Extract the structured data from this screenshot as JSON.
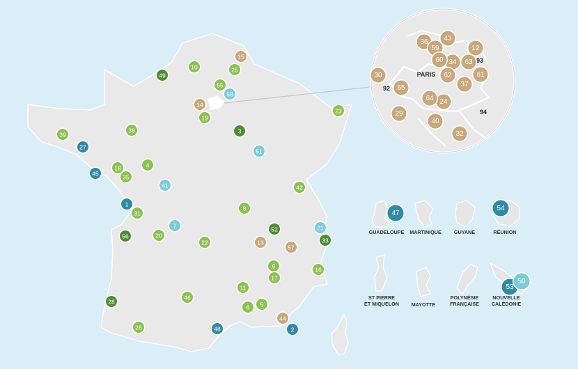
{
  "colors": {
    "lightgreen": "#8cc152",
    "darkgreen": "#4e8c34",
    "tan": "#c9a77a",
    "lightblue": "#7ccbd8",
    "teal": "#2f8aa6"
  },
  "paris_label": "PARIS",
  "depts": [
    "92",
    "93",
    "94"
  ],
  "territories": [
    "GUADELOUPE",
    "MARTINIQUE",
    "GUYANE",
    "RÉUNION",
    "ST PIERRE ET MIQUELON",
    "MAYOTTE",
    "POLYNÉSIE FRANÇAISE",
    "NOUVELLE CALÉDONIE"
  ],
  "territory_lines": [
    [
      "GUADELOUPE"
    ],
    [
      "MARTINIQUE"
    ],
    [
      "GUYANE"
    ],
    [
      "RÉUNION"
    ],
    [
      "ST PIERRE",
      "ET MIQUELON"
    ],
    [
      "MAYOTTE"
    ],
    [
      "POLYNÉSIE",
      "FRANÇAISE"
    ],
    [
      "NOUVELLE",
      "CALÉDONIE"
    ]
  ],
  "markers": [
    {
      "n": "1",
      "c": "teal"
    },
    {
      "n": "2",
      "c": "teal"
    },
    {
      "n": "3",
      "c": "darkgreen"
    },
    {
      "n": "4",
      "c": "lightgreen"
    },
    {
      "n": "5",
      "c": "lightgreen"
    },
    {
      "n": "6",
      "c": "lightgreen"
    },
    {
      "n": "7",
      "c": "lightblue"
    },
    {
      "n": "8",
      "c": "lightgreen"
    },
    {
      "n": "9",
      "c": "lightgreen"
    },
    {
      "n": "10",
      "c": "lightgreen"
    },
    {
      "n": "11",
      "c": "lightgreen"
    },
    {
      "n": "13",
      "c": "tan"
    },
    {
      "n": "14",
      "c": "tan"
    },
    {
      "n": "15",
      "c": "tan"
    },
    {
      "n": "16",
      "c": "lightgreen"
    },
    {
      "n": "17",
      "c": "lightgreen"
    },
    {
      "n": "18",
      "c": "lightgreen"
    },
    {
      "n": "19",
      "c": "lightgreen"
    },
    {
      "n": "20",
      "c": "lightgreen"
    },
    {
      "n": "21",
      "c": "lightblue"
    },
    {
      "n": "22",
      "c": "lightgreen"
    },
    {
      "n": "23",
      "c": "lightgreen"
    },
    {
      "n": "25",
      "c": "lightgreen"
    },
    {
      "n": "26",
      "c": "lightgreen"
    },
    {
      "n": "27",
      "c": "teal"
    },
    {
      "n": "28",
      "c": "darkgreen"
    },
    {
      "n": "31",
      "c": "lightgreen"
    },
    {
      "n": "33",
      "c": "darkgreen"
    },
    {
      "n": "35",
      "c": "lightgreen"
    },
    {
      "n": "38",
      "c": "lightgreen"
    },
    {
      "n": "39",
      "c": "lightgreen"
    },
    {
      "n": "41",
      "c": "lightblue"
    },
    {
      "n": "42",
      "c": "lightgreen"
    },
    {
      "n": "44",
      "c": "tan"
    },
    {
      "n": "45",
      "c": "teal"
    },
    {
      "n": "46",
      "c": "lightgreen"
    },
    {
      "n": "48",
      "c": "teal"
    },
    {
      "n": "49",
      "c": "darkgreen"
    },
    {
      "n": "51",
      "c": "lightblue"
    },
    {
      "n": "52",
      "c": "darkgreen"
    },
    {
      "n": "55",
      "c": "lightgreen"
    },
    {
      "n": "56",
      "c": "darkgreen"
    },
    {
      "n": "57",
      "c": "tan"
    },
    {
      "n": "58",
      "c": "lightblue"
    },
    {
      "n": "12",
      "c": "tan"
    },
    {
      "n": "24",
      "c": "tan"
    },
    {
      "n": "29",
      "c": "tan"
    },
    {
      "n": "30",
      "c": "tan"
    },
    {
      "n": "32",
      "c": "tan"
    },
    {
      "n": "34",
      "c": "tan"
    },
    {
      "n": "36",
      "c": "tan"
    },
    {
      "n": "37",
      "c": "tan"
    },
    {
      "n": "40",
      "c": "tan"
    },
    {
      "n": "43",
      "c": "tan"
    },
    {
      "n": "59",
      "c": "tan"
    },
    {
      "n": "60",
      "c": "tan"
    },
    {
      "n": "61",
      "c": "tan"
    },
    {
      "n": "62",
      "c": "tan"
    },
    {
      "n": "63",
      "c": "tan"
    },
    {
      "n": "64",
      "c": "tan"
    },
    {
      "n": "65",
      "c": "tan"
    },
    {
      "n": "47",
      "c": "teal"
    },
    {
      "n": "54",
      "c": "teal"
    },
    {
      "n": "53",
      "c": "teal"
    },
    {
      "n": "50",
      "c": "lightblue"
    }
  ]
}
